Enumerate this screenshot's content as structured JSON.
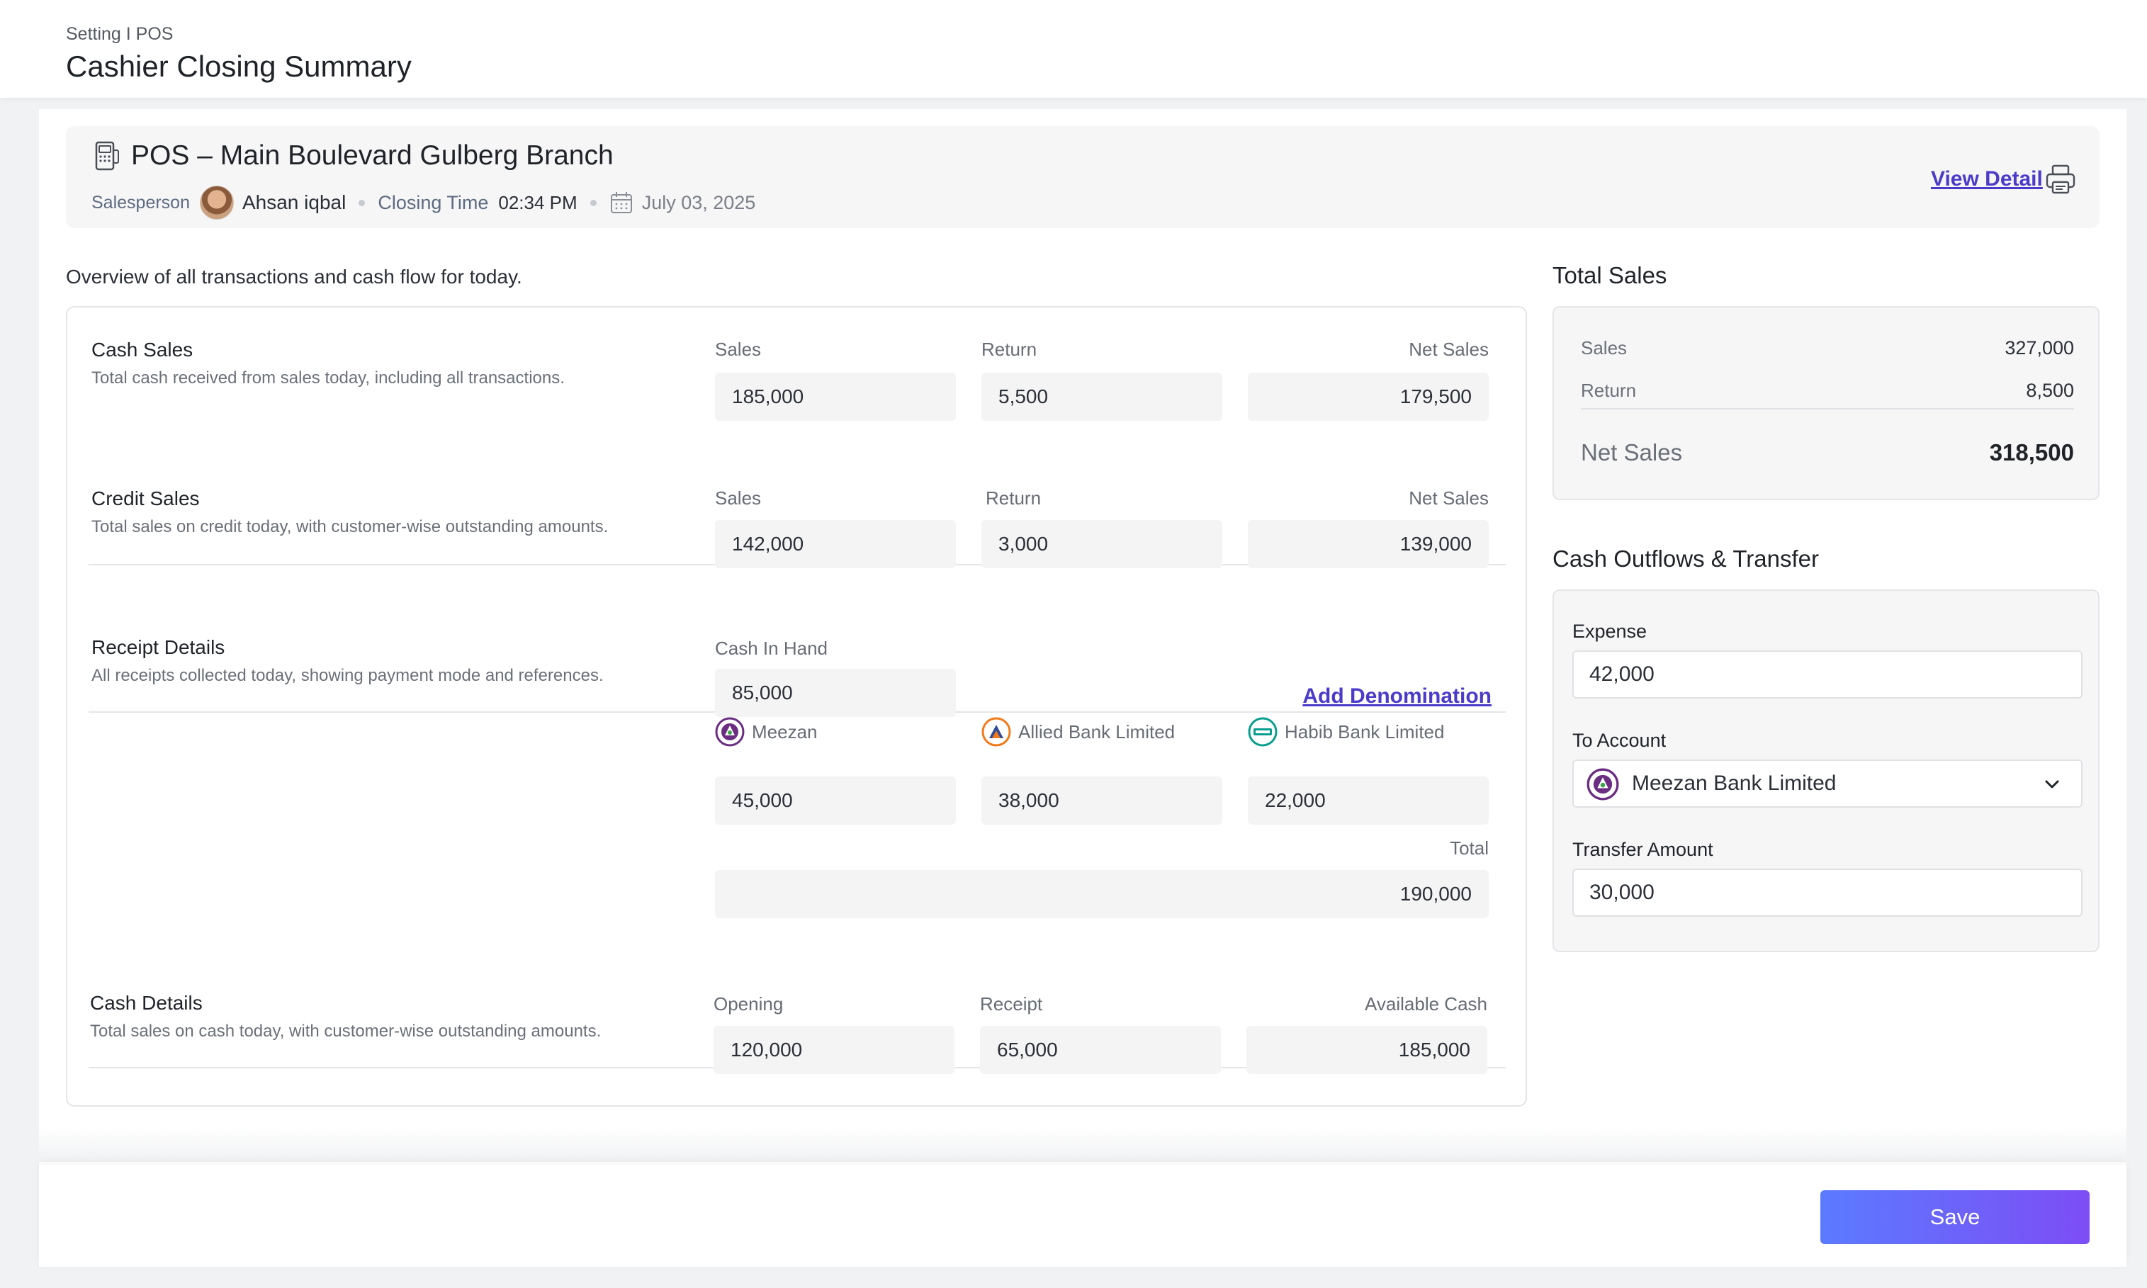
{
  "header": {
    "breadcrumb": "Setting I POS",
    "title": "Cashier Closing Summary"
  },
  "pos": {
    "name": "POS – Main Boulevard Gulberg Branch",
    "salesperson_label": "Salesperson",
    "salesperson_name": "Ahsan iqbal",
    "closing_time_label": "Closing Time",
    "closing_time": "02:34 PM",
    "date": "July 03, 2025",
    "view_detail": "View Detail",
    "icons": [
      "pos-terminal-icon",
      "calendar-icon",
      "printer-icon"
    ]
  },
  "overview": "Overview of all transactions and cash flow for today.",
  "cash_sales": {
    "title": "Cash Sales",
    "desc": "Total cash received from sales today, including all transactions.",
    "sales_label": "Sales",
    "sales": "185,000",
    "return_label": "Return",
    "return": "5,500",
    "net_label": "Net Sales",
    "net": "179,500"
  },
  "credit_sales": {
    "title": "Credit Sales",
    "desc": "Total sales on credit today, with customer-wise outstanding amounts.",
    "sales_label": "Sales",
    "sales": "142,000",
    "return_label": "Return",
    "return": "3,000",
    "net_label": "Net Sales",
    "net": "139,000"
  },
  "receipt": {
    "title": "Receipt Details",
    "desc": "All receipts collected today, showing payment mode and references.",
    "cash_in_hand_label": "Cash In Hand",
    "cash_in_hand": "85,000",
    "add_denomination": "Add Denomination",
    "banks": [
      {
        "name": "Meezan",
        "value": "45,000",
        "logo_color": "#6b2d82"
      },
      {
        "name": "Allied Bank Limited",
        "value": "38,000",
        "logo_color": "#f07a1a"
      },
      {
        "name": "Habib Bank Limited",
        "value": "22,000",
        "logo_color": "#0a9e8f"
      }
    ],
    "total_label": "Total",
    "total": "190,000"
  },
  "cash_details": {
    "title": "Cash Details",
    "desc": "Total sales on cash today, with customer-wise outstanding amounts.",
    "opening_label": "Opening",
    "opening": "120,000",
    "receipt_label": "Receipt",
    "receipt": "65,000",
    "available_label": "Available Cash",
    "available": "185,000"
  },
  "total_sales": {
    "title": "Total Sales",
    "sales_label": "Sales",
    "sales": "327,000",
    "return_label": "Return",
    "return": "8,500",
    "net_label": "Net Sales",
    "net": "318,500"
  },
  "outflows": {
    "title": "Cash Outflows & Transfer",
    "expense_label": "Expense",
    "expense": "42,000",
    "account_label": "To Account",
    "account": "Meezan Bank Limited",
    "transfer_label": "Transfer Amount",
    "transfer": "30,000"
  },
  "footer": {
    "save_label": "Save"
  },
  "colors": {
    "accent": "#4b3bc9",
    "button_start": "#5b7bff",
    "button_end": "#7d4df5"
  }
}
